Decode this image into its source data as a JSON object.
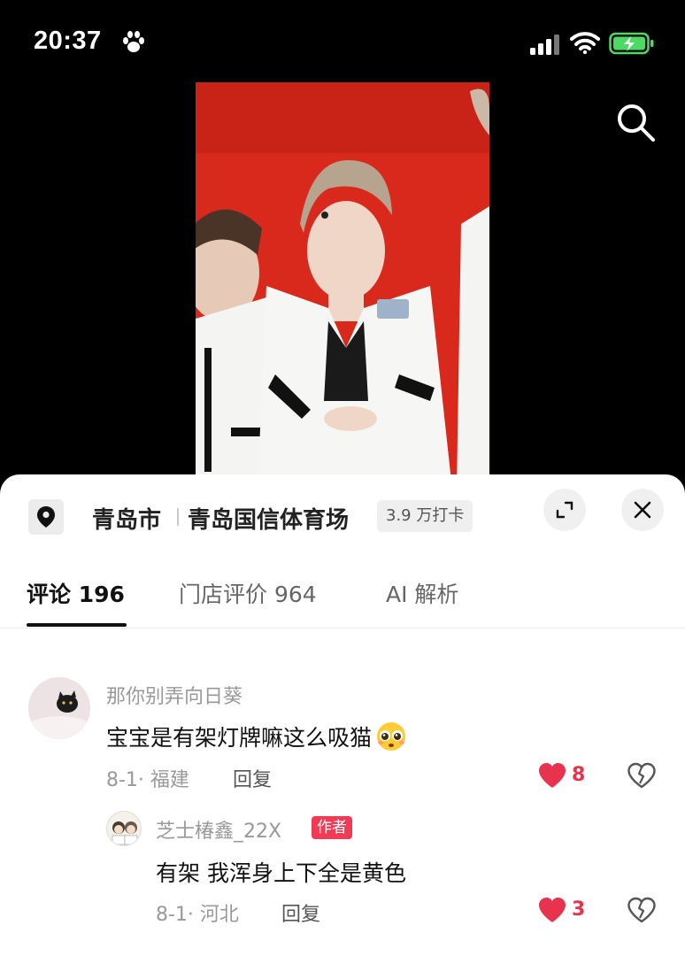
{
  "status_bar": {
    "time": "20:37",
    "icons": [
      "paw-icon",
      "cellular-signal-icon",
      "wifi-icon",
      "battery-charging-icon"
    ],
    "battery_color": "#4cd964"
  },
  "video": {
    "background_color": "#d9281c"
  },
  "location": {
    "city": "青岛市",
    "venue": "青岛国信体育场",
    "checkins": "3.9 万打卡"
  },
  "tabs": [
    {
      "label": "评论 196",
      "active": true
    },
    {
      "label": "门店评价 964",
      "active": false
    },
    {
      "label": "AI 解析",
      "active": false
    }
  ],
  "comments": [
    {
      "username": "那你别弄向日葵",
      "text": "宝宝是有架灯牌嘛这么吸猫",
      "emoji": "pleading-face-emoji",
      "date_location": "8-1· 福建",
      "reply_label": "回复",
      "likes": "8",
      "liked": true,
      "replies": [
        {
          "username": "芝士椿鑫_22X",
          "badge": "作者",
          "text": "有架 我浑身上下全是黄色",
          "date_location": "8-1· 河北",
          "reply_label": "回复",
          "likes": "3",
          "liked": true
        }
      ]
    }
  ],
  "colors": {
    "accent_red": "#e8334f",
    "badge_red": "#f23a55"
  }
}
